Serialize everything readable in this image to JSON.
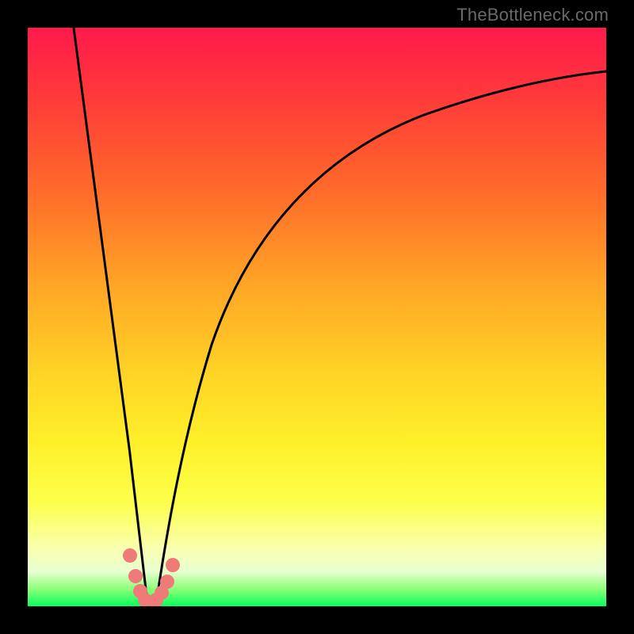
{
  "watermark": {
    "text": "TheBottleneck.com"
  },
  "chart_data": {
    "type": "line",
    "title": "",
    "xlabel": "",
    "ylabel": "",
    "xlim": [
      0,
      100
    ],
    "ylim": [
      0,
      100
    ],
    "grid": false,
    "legend": null,
    "background_gradient": {
      "top_color": "#ff1a4b",
      "bottom_color": "#06ff5a",
      "meaning": "top=high bottleneck, bottom=low bottleneck"
    },
    "series": [
      {
        "name": "left-branch",
        "color": "#000000",
        "x": [
          8,
          10,
          12,
          14,
          16,
          17,
          18,
          18.8,
          19.3,
          19.6
        ],
        "y": [
          100,
          86,
          72,
          58,
          43,
          31,
          19,
          10,
          4,
          1
        ]
      },
      {
        "name": "right-branch",
        "color": "#000000",
        "x": [
          22,
          23,
          25,
          28,
          32,
          38,
          46,
          56,
          68,
          82,
          100
        ],
        "y": [
          2,
          7,
          18,
          32,
          45,
          57,
          67,
          74,
          79,
          83,
          86
        ]
      },
      {
        "name": "minimum-peach-dots",
        "color": "#ef7b78",
        "type": "scatter",
        "x": [
          17.5,
          18.3,
          19.0,
          19.6,
          20.2,
          20.9,
          21.6,
          22.4,
          23.2
        ],
        "y": [
          9.0,
          5.0,
          2.3,
          1.0,
          0.7,
          1.0,
          2.0,
          4.0,
          7.5
        ]
      }
    ],
    "minimum_point": {
      "x": 20.2,
      "y": 0.7
    }
  }
}
